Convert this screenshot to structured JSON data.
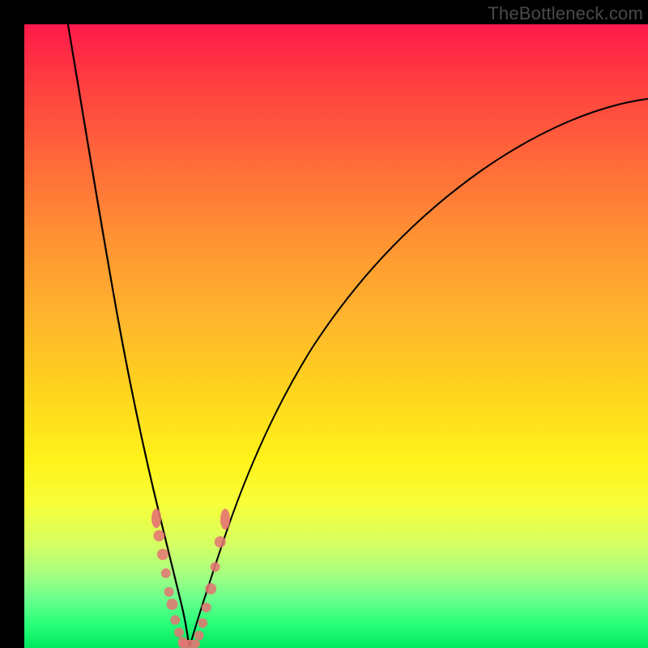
{
  "watermark": "TheBottleneck.com",
  "colors": {
    "dot": "#e57373",
    "curve": "#000000",
    "gradient_top": "#ff1a4a",
    "gradient_bottom": "#00e85f"
  },
  "chart_data": {
    "type": "line",
    "title": "",
    "xlabel": "",
    "ylabel": "",
    "xlim": [
      0,
      100
    ],
    "ylim": [
      0,
      100
    ],
    "grid": false,
    "legend": false,
    "note": "V-shaped bottleneck curve. Values are approximate y-positions (0 = bottom / best match, 100 = top / worst) read from the figure at sampled x positions.",
    "series": [
      {
        "name": "left-branch",
        "x": [
          7,
          10,
          13,
          16,
          19,
          21,
          23,
          24.5,
          25.5,
          26.5
        ],
        "y": [
          100,
          83,
          67,
          51,
          35,
          22,
          12,
          5,
          1,
          0
        ]
      },
      {
        "name": "right-branch",
        "x": [
          26.5,
          28,
          30,
          33,
          37,
          43,
          51,
          61,
          74,
          88,
          100
        ],
        "y": [
          0,
          2,
          8,
          18,
          31,
          45,
          58,
          69,
          78,
          84,
          88
        ]
      }
    ],
    "markers": {
      "description": "Salmon-colored dots/pills clustered near the vertex along both branches, roughly in the y-range 0–22.",
      "left_branch_points": [
        [
          21.0,
          22
        ],
        [
          21.6,
          18
        ],
        [
          22.2,
          15
        ],
        [
          22.7,
          12
        ],
        [
          23.2,
          9
        ],
        [
          23.7,
          7
        ],
        [
          24.2,
          4.5
        ],
        [
          24.8,
          2.5
        ],
        [
          25.4,
          1.0
        ]
      ],
      "right_branch_points": [
        [
          28.0,
          2
        ],
        [
          28.6,
          4
        ],
        [
          29.2,
          6.5
        ],
        [
          29.9,
          9.5
        ],
        [
          30.6,
          13
        ],
        [
          31.4,
          17
        ],
        [
          32.3,
          21
        ]
      ],
      "vertex_pill": {
        "x_center": 26.4,
        "y": 0,
        "half_width_x": 1.7
      }
    }
  }
}
